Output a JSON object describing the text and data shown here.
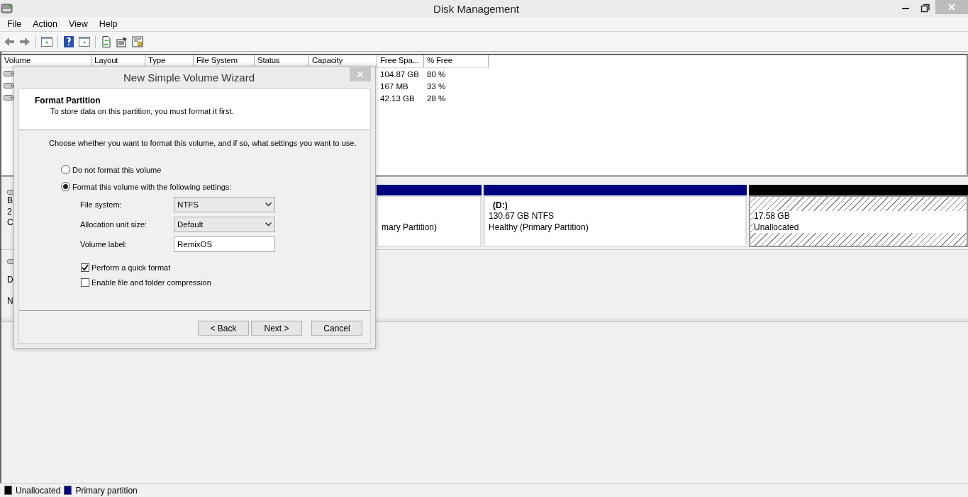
{
  "window": {
    "title": "Disk Management"
  },
  "menu": [
    {
      "label": "File"
    },
    {
      "label": "Action"
    },
    {
      "label": "View"
    },
    {
      "label": "Help"
    }
  ],
  "volume_list": {
    "columns": [
      "Volume",
      "Layout",
      "Type",
      "File System",
      "Status",
      "Capacity",
      "Free Spa...",
      "% Free"
    ],
    "rows": [
      {
        "free_space": "104.87 GB",
        "percent_free": "80 %"
      },
      {
        "free_space": "167 MB",
        "percent_free": "33 %"
      },
      {
        "free_space": "42.13 GB",
        "percent_free": "28 %"
      }
    ]
  },
  "disks": [
    {
      "label_lines": [
        "B",
        "2",
        "C"
      ],
      "partitions": [
        {
          "kind": "primary",
          "lines": [
            "mary Partition)"
          ]
        },
        {
          "kind": "primary",
          "title": "(D:)",
          "lines": [
            "130.67 GB NTFS",
            "Healthy (Primary Partition)"
          ]
        },
        {
          "kind": "unallocated",
          "lines": [
            "17.58 GB",
            "Unallocated"
          ]
        }
      ]
    },
    {
      "label_lines": [
        "D",
        "N"
      ]
    }
  ],
  "legend": [
    {
      "label": "Unallocated",
      "color": "#000000"
    },
    {
      "label": "Primary partition",
      "color": "#000080"
    }
  ],
  "dialog": {
    "title": "New Simple Volume Wizard",
    "heading": "Format Partition",
    "subheading": "To store data on this partition, you must format it first.",
    "prompt": "Choose whether you want to format this volume, and if so, what settings you want to use.",
    "options": [
      {
        "label": "Do not format this volume",
        "selected": false
      },
      {
        "label": "Format this volume with the following settings:",
        "selected": true
      }
    ],
    "settings": [
      {
        "kind": "select",
        "label": "File system:",
        "value": "NTFS"
      },
      {
        "kind": "select",
        "label": "Allocation unit size:",
        "value": "Default"
      },
      {
        "kind": "text",
        "label": "Volume label:",
        "value": "RemixOS"
      }
    ],
    "checkboxes": [
      {
        "label": "Perform a quick format",
        "checked": true
      },
      {
        "label": "Enable file and folder compression",
        "checked": false
      }
    ],
    "buttons": [
      "< Back",
      "Next >",
      "Cancel"
    ]
  }
}
